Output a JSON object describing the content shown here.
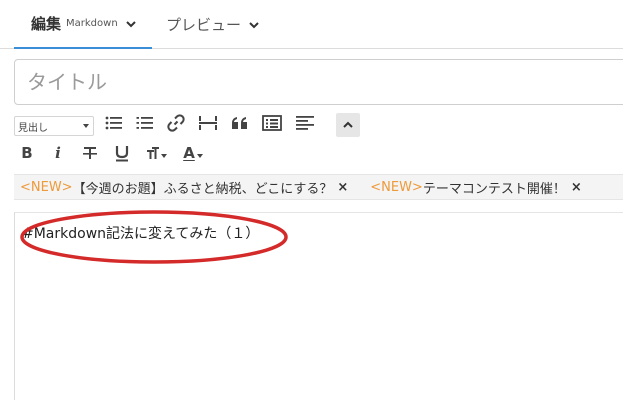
{
  "tabs": {
    "edit": {
      "label": "編集",
      "sub": "Markdown"
    },
    "preview": {
      "label": "プレビュー"
    }
  },
  "title": {
    "placeholder": "タイトル",
    "value": ""
  },
  "toolbar": {
    "heading_select": "見出し",
    "row1_icons": [
      "list-ul-icon",
      "list-ol-icon",
      "link-icon",
      "horizontal-rule-icon",
      "quote-icon",
      "table-icon",
      "text-align-icon",
      "chevron-up-icon"
    ],
    "row2": {
      "bold": "B",
      "italic": "i",
      "font_size": "T",
      "font_color": "A"
    }
  },
  "notices": [
    {
      "tag": "<NEW>",
      "text": "【今週のお題】ふるさと納税、どこにする？",
      "close": "×"
    },
    {
      "tag": "<NEW>",
      "text": "テーマコンテスト開催！",
      "close": "×"
    }
  ],
  "editor": {
    "content": "#Markdown記法に変えてみた（１）"
  },
  "colors": {
    "accent": "#3a8ed6",
    "new_tag": "#ee9a3a",
    "annotation": "#d42a2a"
  }
}
